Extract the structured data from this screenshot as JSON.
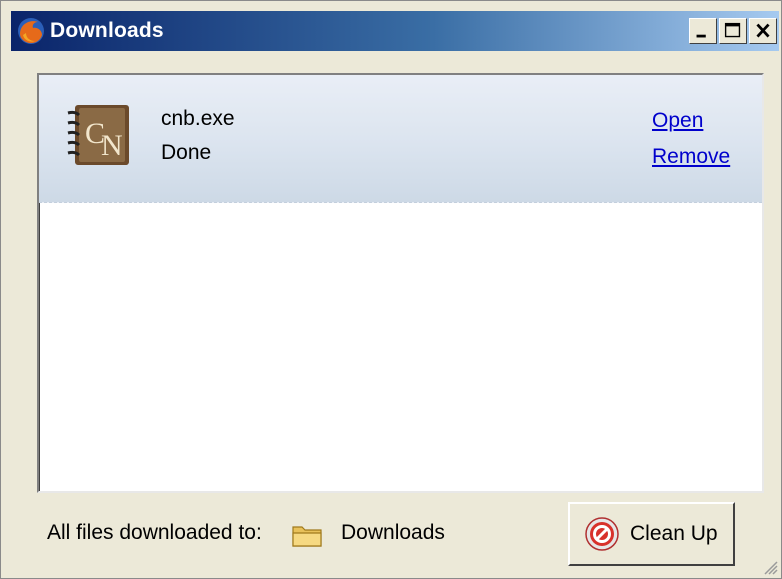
{
  "window": {
    "title": "Downloads",
    "app_icon": "firefox-icon",
    "controls": {
      "minimize": "minimize-icon",
      "maximize": "maximize-icon",
      "close": "close-icon"
    }
  },
  "downloads": [
    {
      "icon": "cardnote-app-icon",
      "filename": "cnb.exe",
      "status": "Done",
      "open_label": "Open",
      "remove_label": "Remove"
    }
  ],
  "footer": {
    "label": "All files downloaded to:",
    "folder_icon": "folder-icon",
    "folder_name": "Downloads",
    "cleanup_label": "Clean Up",
    "cleanup_icon": "stop-icon"
  },
  "colors": {
    "title_start": "#0a246a",
    "title_end": "#a6caf0",
    "link": "#0000cc",
    "window_bg": "#ece9d8"
  }
}
